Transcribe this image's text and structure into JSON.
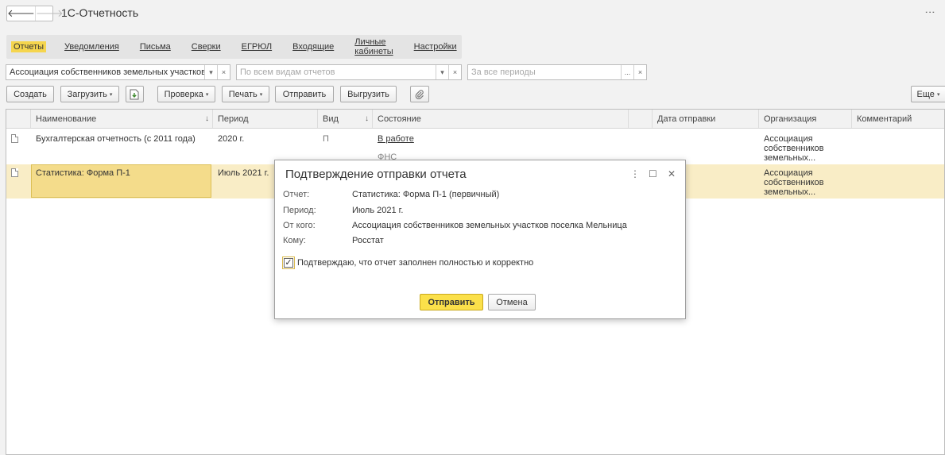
{
  "app": {
    "title": "1С-Отчетность",
    "back_glyph": "🡐",
    "fwd_glyph": "🡒",
    "more_glyph": "⋮"
  },
  "tabs": [
    {
      "label": "Отчеты",
      "active": true
    },
    {
      "label": "Уведомления",
      "active": false
    },
    {
      "label": "Письма",
      "active": false
    },
    {
      "label": "Сверки",
      "active": false
    },
    {
      "label": "ЕГРЮЛ",
      "active": false
    },
    {
      "label": "Входящие",
      "active": false
    },
    {
      "label": "Личные кабинеты",
      "active": false
    },
    {
      "label": "Настройки",
      "active": false
    }
  ],
  "filters": {
    "organization": {
      "value": "Ассоциация собственников земельных участков"
    },
    "report_kind": {
      "placeholder": "По всем видам отчетов"
    },
    "period": {
      "placeholder": "За все периоды"
    },
    "dropdown_glyph": "▾",
    "clear_glyph": "×",
    "select_glyph": "..."
  },
  "toolbar": {
    "create": "Создать",
    "upload": "Загрузить",
    "check": "Проверка",
    "print": "Печать",
    "send": "Отправить",
    "export": "Выгрузить",
    "more": "Еще",
    "caret": "▾"
  },
  "table": {
    "columns": {
      "name": "Наименование",
      "period": "Период",
      "kind": "Вид",
      "state": "Состояние",
      "sent_date": "Дата отправки",
      "organization": "Организация",
      "comment": "Комментарий"
    },
    "sort_glyph": "↓",
    "rows": [
      {
        "name": "Бухгалтерская отчетность (с 2011 года)",
        "period": "2020 г.",
        "kind": "П",
        "state": "В работе",
        "state_sub": "ФНС",
        "organization": [
          "Ассоциация",
          "собственников",
          "земельных..."
        ]
      },
      {
        "name": "Статистика: Форма П-1",
        "period": "Июль 2021 г.",
        "organization": [
          "Ассоциация",
          "собственников",
          "земельных..."
        ],
        "selected": true
      }
    ]
  },
  "dialog": {
    "title": "Подтверждение отправки отчета",
    "fields": [
      {
        "label": "Отчет:",
        "value": "Статистика: Форма П-1 (первичный)"
      },
      {
        "label": "Период:",
        "value": "Июль 2021 г."
      },
      {
        "label": "От кого:",
        "value": "Ассоциация собственников земельных участков поселка Мельница"
      },
      {
        "label": "Кому:",
        "value": "Росстат"
      }
    ],
    "confirm_label": "Подтверждаю, что отчет заполнен полностью и корректно",
    "confirm_checked": true,
    "check_glyph": "✓",
    "send_button": "Отправить",
    "cancel_button": "Отмена",
    "more_glyph": "⋮",
    "maximize_glyph": "☐",
    "close_glyph": "✕"
  },
  "colors": {
    "accent": "#f5d54e",
    "selection_row": "#f9edc6",
    "selection_cell": "#f4dc8b",
    "primary_button": "#fbe04a"
  }
}
